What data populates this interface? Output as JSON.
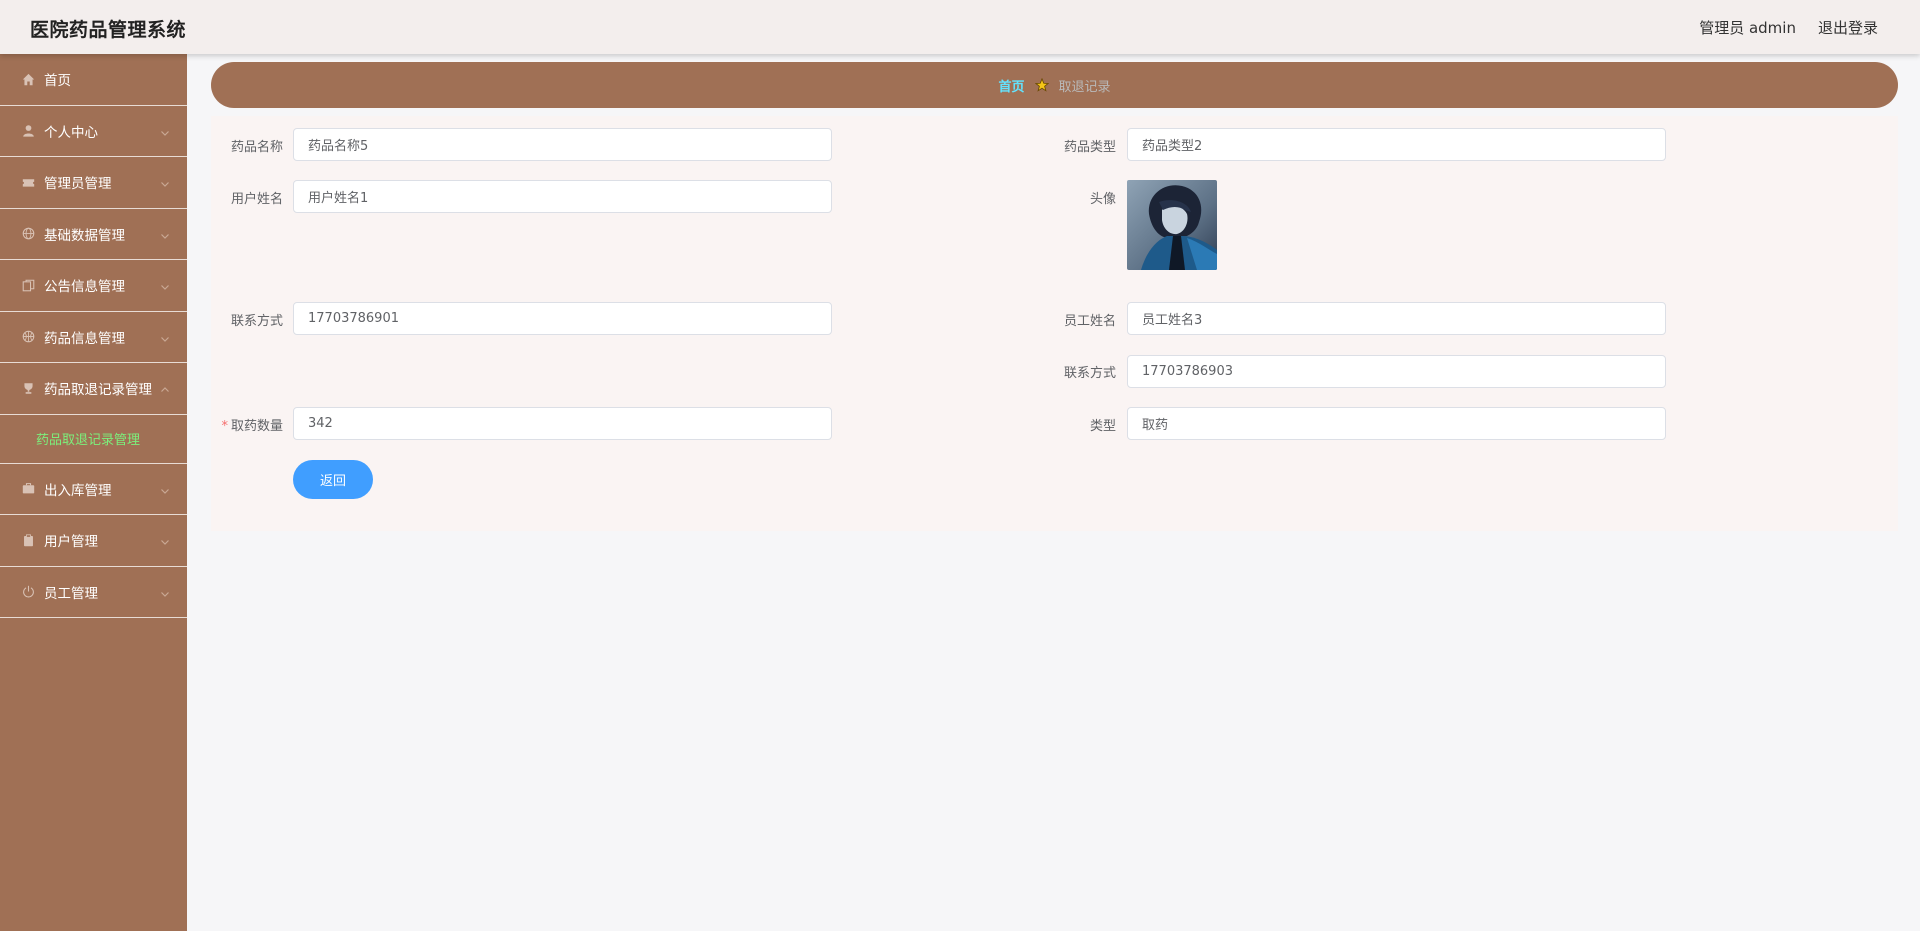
{
  "header": {
    "title": "医院药品管理系统",
    "user_label": "管理员 admin",
    "logout_label": "退出登录"
  },
  "sidebar": {
    "items": [
      {
        "label": "首页",
        "icon": "home-icon",
        "has_arrow": false
      },
      {
        "label": "个人中心",
        "icon": "user-icon",
        "has_arrow": true
      },
      {
        "label": "管理员管理",
        "icon": "ticket-icon",
        "has_arrow": true
      },
      {
        "label": "基础数据管理",
        "icon": "globe-icon",
        "has_arrow": true
      },
      {
        "label": "公告信息管理",
        "icon": "copy-icon",
        "has_arrow": true
      },
      {
        "label": "药品信息管理",
        "icon": "basketball-icon",
        "has_arrow": true
      },
      {
        "label": "药品取退记录管理",
        "icon": "trophy-icon",
        "has_arrow": true,
        "expanded": true
      },
      {
        "label": "出入库管理",
        "icon": "briefcase-icon",
        "has_arrow": true
      },
      {
        "label": "用户管理",
        "icon": "clipboard-icon",
        "has_arrow": true
      },
      {
        "label": "员工管理",
        "icon": "power-icon",
        "has_arrow": true
      }
    ],
    "active_submenu": "药品取退记录管理"
  },
  "breadcrumb": {
    "home": "首页",
    "current": "取退记录"
  },
  "form": {
    "drug_name_label": "药品名称",
    "drug_name_value": "药品名称5",
    "drug_type_label": "药品类型",
    "drug_type_value": "药品类型2",
    "user_name_label": "用户姓名",
    "user_name_value": "用户姓名1",
    "avatar_label": "头像",
    "user_contact_label": "联系方式",
    "user_contact_value": "17703786901",
    "staff_name_label": "员工姓名",
    "staff_name_value": "员工姓名3",
    "staff_contact_label": "联系方式",
    "staff_contact_value": "17703786903",
    "quantity_required_mark": "*",
    "quantity_label": "取药数量",
    "quantity_value": "342",
    "type_label": "类型",
    "type_value": "取药",
    "back_button": "返回"
  },
  "colors": {
    "sidebar_bg": "#a07055",
    "header_bg": "#f3eeed",
    "breadcrumb_home": "#63e3ff",
    "submenu_active": "#7cf07c",
    "primary_button": "#409eff"
  }
}
